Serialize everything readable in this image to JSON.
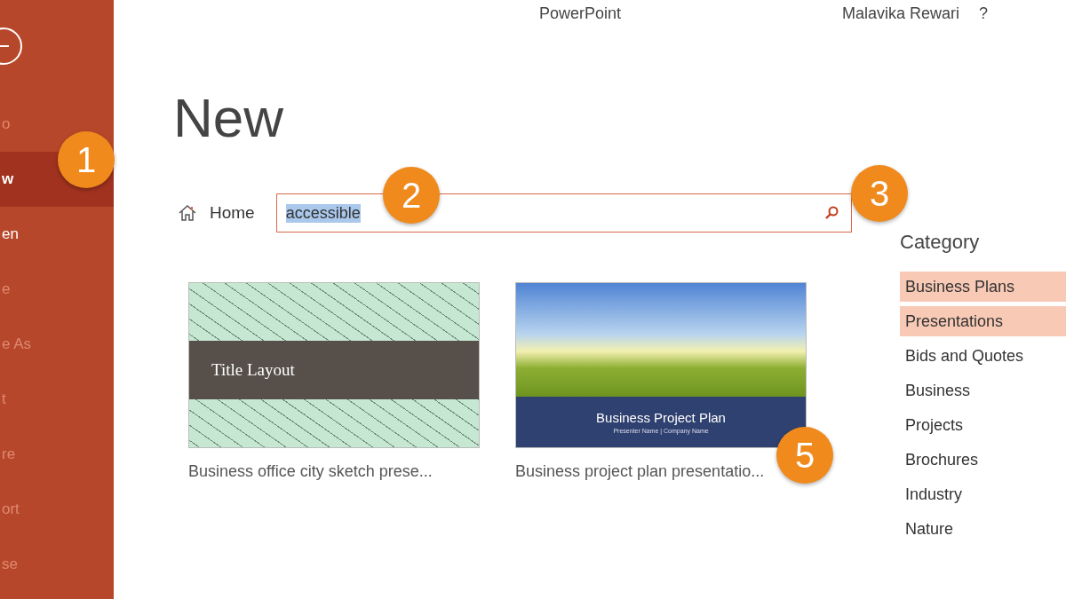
{
  "app_title": "PowerPoint",
  "user_name": "Malavika Rewari",
  "help": "?",
  "sidebar": {
    "items": [
      {
        "label": "o",
        "selected": false,
        "disabled": true
      },
      {
        "label": "w",
        "selected": true,
        "disabled": false
      },
      {
        "label": "en",
        "selected": false,
        "disabled": false
      },
      {
        "label": "e",
        "selected": false,
        "disabled": true
      },
      {
        "label": "e As",
        "selected": false,
        "disabled": true
      },
      {
        "label": "t",
        "selected": false,
        "disabled": true
      },
      {
        "label": "re",
        "selected": false,
        "disabled": true
      },
      {
        "label": "ort",
        "selected": false,
        "disabled": true
      },
      {
        "label": "se",
        "selected": false,
        "disabled": true
      }
    ]
  },
  "page_title": "New",
  "home_link": "Home",
  "search": {
    "value": "accessible"
  },
  "templates": [
    {
      "kind": "sketch",
      "slide_title": "Title Layout",
      "caption": "Business office city sketch prese..."
    },
    {
      "kind": "landscape",
      "slide_title": "Business Project Plan",
      "slide_subtitle": "Presenter Name | Company Name",
      "caption": "Business project plan presentatio..."
    }
  ],
  "category": {
    "heading": "Category",
    "items": [
      {
        "label": "Business Plans",
        "selected": true
      },
      {
        "label": "Presentations",
        "selected": true
      },
      {
        "label": "Bids and Quotes",
        "selected": false
      },
      {
        "label": "Business",
        "selected": false
      },
      {
        "label": "Projects",
        "selected": false
      },
      {
        "label": "Brochures",
        "selected": false
      },
      {
        "label": "Industry",
        "selected": false
      },
      {
        "label": "Nature",
        "selected": false
      }
    ]
  },
  "callouts": [
    "1",
    "2",
    "3",
    "5"
  ]
}
